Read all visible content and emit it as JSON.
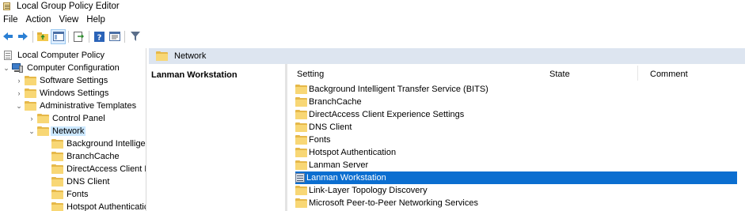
{
  "window": {
    "title": "Local Group Policy Editor"
  },
  "menu": [
    "File",
    "Action",
    "View",
    "Help"
  ],
  "toolbar": {
    "buttons": [
      "back-arrow-icon",
      "forward-arrow-icon",
      "up-folder-icon",
      "show-hide-tree-icon",
      "export-list-icon",
      "help-icon",
      "properties-icon",
      "filter-icon"
    ]
  },
  "tree": {
    "nodes": [
      {
        "label": "Local Computer Policy"
      },
      {
        "label": "Computer Configuration"
      },
      {
        "label": "Software Settings"
      },
      {
        "label": "Windows Settings"
      },
      {
        "label": "Administrative Templates"
      },
      {
        "label": "Control Panel"
      },
      {
        "label": "Network"
      },
      {
        "label": "Background Intelligen"
      },
      {
        "label": "BranchCache"
      },
      {
        "label": "DirectAccess Client Ex"
      },
      {
        "label": "DNS Client"
      },
      {
        "label": "Fonts"
      },
      {
        "label": "Hotspot Authenticatic"
      }
    ]
  },
  "header": {
    "title": "Network"
  },
  "description": {
    "title": "Lanman Workstation"
  },
  "list": {
    "columns": {
      "setting": "Setting",
      "state": "State",
      "comment": "Comment"
    },
    "rows": [
      {
        "label": "Background Intelligent Transfer Service (BITS)",
        "icon": "folder-icon"
      },
      {
        "label": "BranchCache",
        "icon": "folder-icon"
      },
      {
        "label": "DirectAccess Client Experience Settings",
        "icon": "folder-icon"
      },
      {
        "label": "DNS Client",
        "icon": "folder-icon"
      },
      {
        "label": "Fonts",
        "icon": "folder-icon"
      },
      {
        "label": "Hotspot Authentication",
        "icon": "folder-icon"
      },
      {
        "label": "Lanman Server",
        "icon": "folder-icon"
      },
      {
        "label": "Lanman Workstation",
        "icon": "setting-icon",
        "selected": true
      },
      {
        "label": "Link-Layer Topology Discovery",
        "icon": "folder-icon"
      },
      {
        "label": "Microsoft Peer-to-Peer Networking Services",
        "icon": "folder-icon"
      }
    ]
  },
  "colors": {
    "selection": "#0b6ed0",
    "header_band": "#dde5f0",
    "folder": "#f8d775"
  }
}
